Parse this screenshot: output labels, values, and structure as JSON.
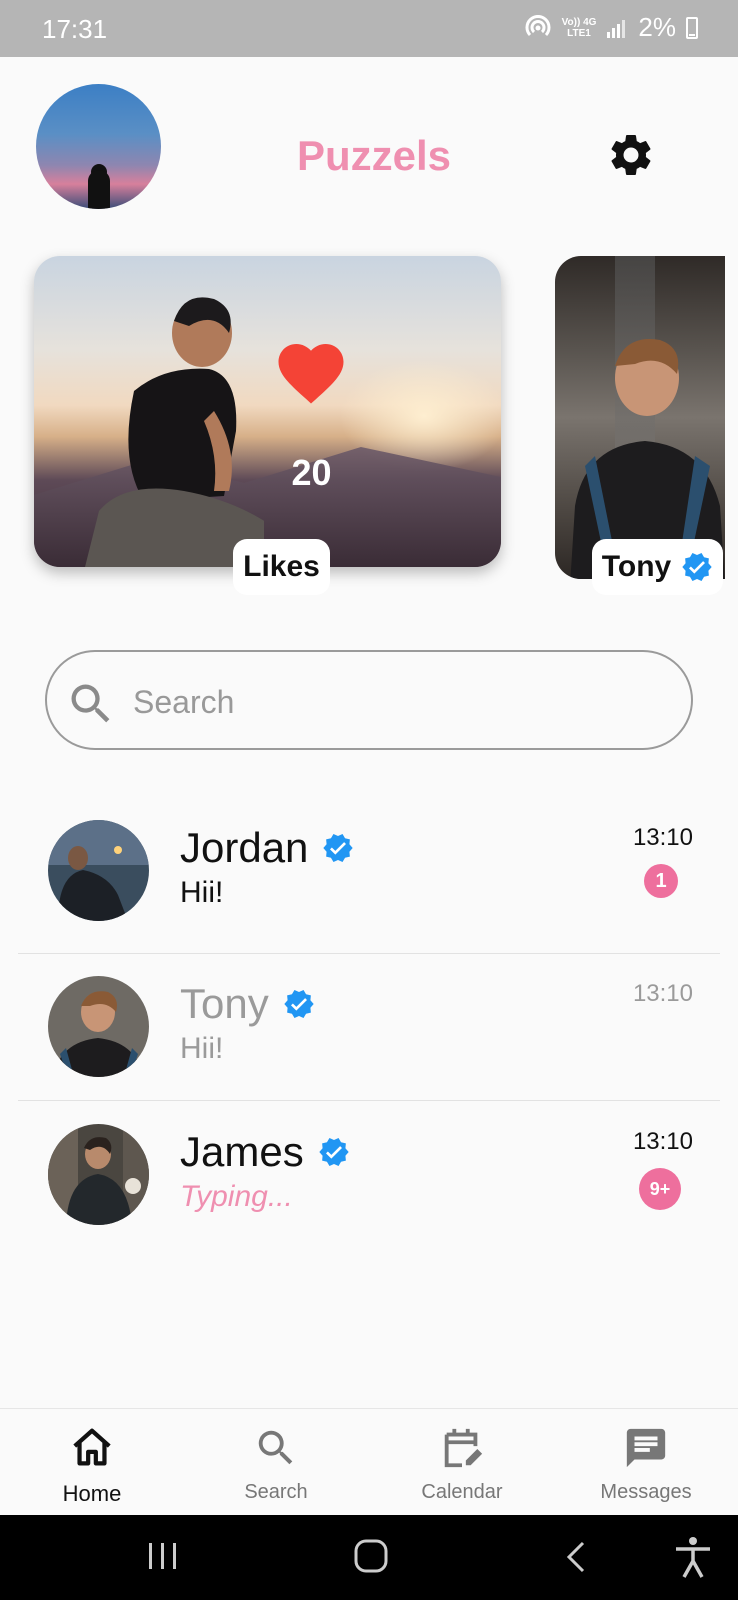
{
  "status_bar": {
    "time": "17:31",
    "network_top": "Vo)) 4G",
    "network_bottom": "LTE1",
    "battery": "2%"
  },
  "header": {
    "title": "Puzzels",
    "title_color": "#ef8fb0"
  },
  "stories": [
    {
      "label": "Likes",
      "count": "20",
      "icon": "heart-icon"
    },
    {
      "label": "Tony",
      "verified": true
    }
  ],
  "search": {
    "placeholder": "Search",
    "value": ""
  },
  "chats": [
    {
      "name": "Jordan",
      "message": "Hii!",
      "time": "13:10",
      "unread": "1",
      "verified": true
    },
    {
      "name": "Tony",
      "message": "Hii!",
      "time": "13:10",
      "unread": "",
      "verified": true
    },
    {
      "name": "James",
      "message": "Typing...",
      "time": "13:10",
      "unread": "9+",
      "verified": true
    }
  ],
  "bottom_nav": {
    "items": [
      {
        "label": "Home",
        "icon": "home-icon",
        "active": true
      },
      {
        "label": "Search",
        "icon": "search-icon",
        "active": false
      },
      {
        "label": "Calendar",
        "icon": "calendar-edit-icon",
        "active": false
      },
      {
        "label": "Messages",
        "icon": "message-icon",
        "active": false
      }
    ]
  },
  "colors": {
    "accent_pink": "#ef8fb0",
    "badge_pink": "#ee6f9d",
    "verified_blue": "#2196f3",
    "heart_red": "#f44336"
  }
}
